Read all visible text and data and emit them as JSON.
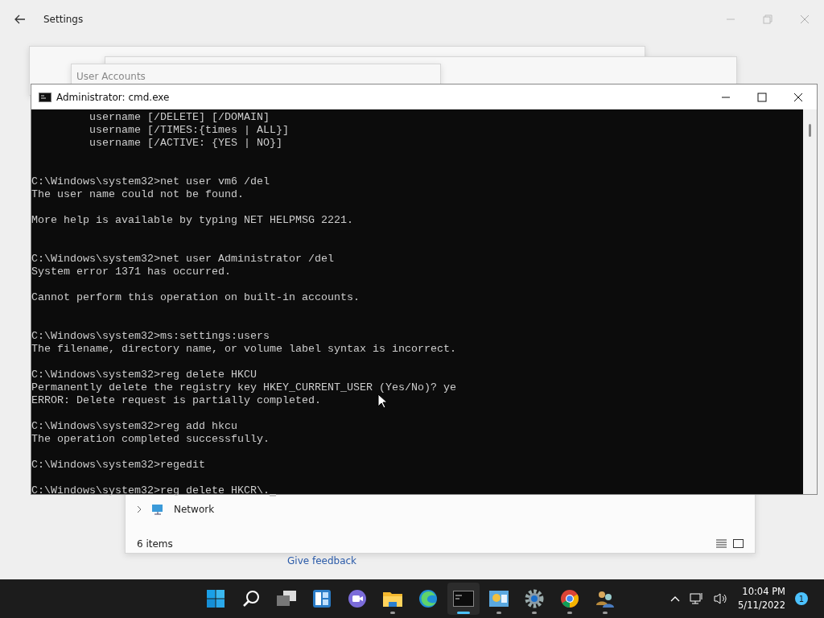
{
  "settings_window": {
    "title": "Settings"
  },
  "background_windows": {
    "user_accounts_title": "User Accounts",
    "explorer": {
      "tree_item": "Network",
      "status": "6 items"
    },
    "feedback_link": "Give feedback"
  },
  "cmd_window": {
    "title": "Administrator: cmd.exe",
    "lines": [
      {
        "kind": "text",
        "text": "         username [/DELETE] [/DOMAIN]"
      },
      {
        "kind": "text",
        "text": "         username [/TIMES:{times | ALL}]"
      },
      {
        "kind": "text",
        "text": "         username [/ACTIVE: {YES | NO}]"
      },
      {
        "kind": "blank"
      },
      {
        "kind": "blank"
      },
      {
        "kind": "text",
        "text": "C:\\Windows\\system32>net user vm6 /del"
      },
      {
        "kind": "text",
        "text": "The user name could not be found."
      },
      {
        "kind": "blank"
      },
      {
        "kind": "text",
        "text": "More help is available by typing NET HELPMSG 2221."
      },
      {
        "kind": "blank"
      },
      {
        "kind": "blank"
      },
      {
        "kind": "text",
        "text": "C:\\Windows\\system32>net user Administrator /del"
      },
      {
        "kind": "text",
        "text": "System error 1371 has occurred."
      },
      {
        "kind": "blank"
      },
      {
        "kind": "text",
        "text": "Cannot perform this operation on built-in accounts."
      },
      {
        "kind": "blank"
      },
      {
        "kind": "blank"
      },
      {
        "kind": "text",
        "text": "C:\\Windows\\system32>ms:settings:users"
      },
      {
        "kind": "text",
        "text": "The filename, directory name, or volume label syntax is incorrect."
      },
      {
        "kind": "blank"
      },
      {
        "kind": "text",
        "text": "C:\\Windows\\system32>reg delete HKCU"
      },
      {
        "kind": "text",
        "text": "Permanently delete the registry key HKEY_CURRENT_USER (Yes/No)? ye"
      },
      {
        "kind": "text",
        "text": "ERROR: Delete request is partially completed."
      },
      {
        "kind": "blank"
      },
      {
        "kind": "text",
        "text": "C:\\Windows\\system32>reg add hkcu"
      },
      {
        "kind": "text",
        "text": "The operation completed successfully."
      },
      {
        "kind": "blank"
      },
      {
        "kind": "text",
        "text": "C:\\Windows\\system32>regedit"
      },
      {
        "kind": "blank"
      },
      {
        "kind": "text",
        "text": "C:\\Windows\\system32>reg delete HKCR\\.",
        "cursor": true
      }
    ]
  },
  "taskbar": {
    "apps": [
      {
        "kind": "start",
        "running": false,
        "selected": false
      },
      {
        "kind": "search",
        "running": false,
        "selected": false
      },
      {
        "kind": "taskview",
        "running": false,
        "selected": false
      },
      {
        "kind": "widgets",
        "running": false,
        "selected": false
      },
      {
        "kind": "chat",
        "running": false,
        "selected": false
      },
      {
        "kind": "folder",
        "running": true,
        "selected": false
      },
      {
        "kind": "browser",
        "running": false,
        "selected": false
      },
      {
        "kind": "terminal",
        "running": true,
        "selected": true
      },
      {
        "kind": "panel",
        "running": true,
        "selected": false
      },
      {
        "kind": "gear",
        "running": true,
        "selected": false
      },
      {
        "kind": "chrome",
        "running": true,
        "selected": false
      },
      {
        "kind": "users",
        "running": true,
        "selected": false
      }
    ],
    "time": "10:04 PM",
    "date": "5/11/2022",
    "notifications": "1"
  }
}
